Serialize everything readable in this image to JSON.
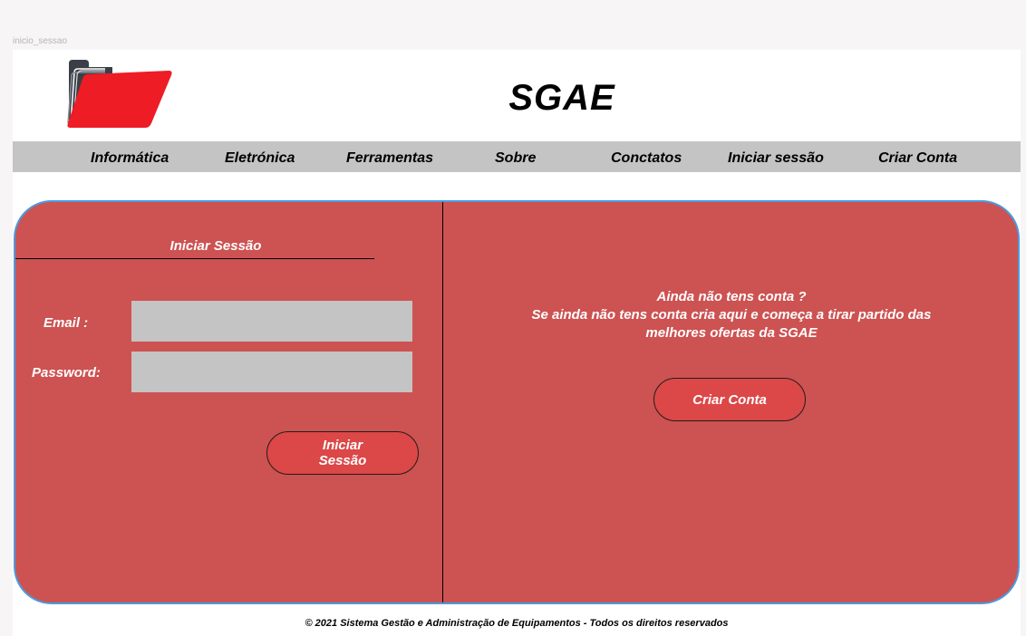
{
  "frame": {
    "label": "inicio_sessao"
  },
  "header": {
    "brand": "SGAE",
    "logo_icon": "folder-icon",
    "accent_color": "#ee1c25"
  },
  "nav": {
    "items": [
      {
        "label": "Informática"
      },
      {
        "label": "Eletrónica"
      },
      {
        "label": "Ferramentas"
      },
      {
        "label": "Sobre"
      },
      {
        "label": "Conctatos"
      },
      {
        "label": "Iniciar sessão"
      },
      {
        "label": "Criar Conta"
      }
    ]
  },
  "login": {
    "title": "Iniciar Sessão",
    "email_label": "Email :",
    "email_value": "",
    "password_label": "Password:",
    "password_value": "",
    "submit_line1": "Iniciar",
    "submit_line2": "Sessão"
  },
  "signup": {
    "line1": "Ainda não tens conta ?",
    "line2": "Se ainda não tens conta cria aqui e começa a tirar partido das",
    "line3": "melhores ofertas da SGAE",
    "button": "Criar Conta"
  },
  "footer": {
    "text": "© 2021 Sistema Gestão e Administração de Equipamentos - Todos os direitos reservados"
  },
  "colors": {
    "panel": "#cd5252",
    "panel_border": "#4a9be0",
    "button": "#dc4747",
    "nav_bg": "#c4c4c4",
    "input_bg": "#c4c4c4"
  }
}
